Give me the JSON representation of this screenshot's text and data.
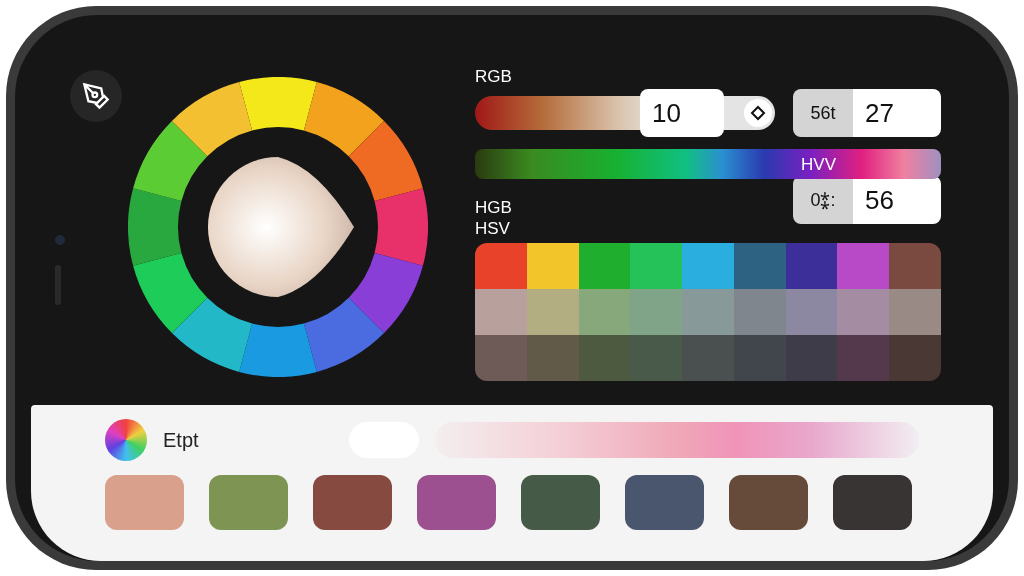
{
  "rgb_slider": {
    "label": "RGB",
    "value": "10"
  },
  "field_top": {
    "label": "56t",
    "value": "27"
  },
  "hue_bar": {
    "label": "HVV"
  },
  "field_bottom": {
    "label": "0⁑:",
    "value": "56"
  },
  "mode_labels": [
    "HGB",
    "HSV"
  ],
  "palette_grid": [
    {
      "cells": [
        {
          "color": "#e8432a"
        },
        {
          "color": "#f2c52a"
        },
        {
          "color": "#1fae2e"
        },
        {
          "color": "#25c25a"
        },
        {
          "color": "#2aaee0"
        },
        {
          "color": "#2d6282"
        },
        {
          "color": "#3c2f9a"
        },
        {
          "color": "#b84ac8"
        },
        {
          "color": "#7a4a40"
        }
      ]
    },
    {
      "cells": [
        {
          "color": "#b8a09c"
        },
        {
          "color": "#b2ae82"
        },
        {
          "color": "#86a87a"
        },
        {
          "color": "#80a488"
        },
        {
          "color": "#88999a"
        },
        {
          "color": "#80868e"
        },
        {
          "color": "#8c88a2"
        },
        {
          "color": "#a48ca2"
        },
        {
          "color": "#9a8a86"
        }
      ]
    },
    {
      "cells": [
        {
          "color": "#6e5a56"
        },
        {
          "color": "#625a48"
        },
        {
          "color": "#4e5a40"
        },
        {
          "color": "#4a5a4a"
        },
        {
          "color": "#4a5050"
        },
        {
          "color": "#40464c"
        },
        {
          "color": "#3e3c48"
        },
        {
          "color": "#54384c"
        },
        {
          "color": "#4a3834"
        }
      ]
    }
  ],
  "bottom": {
    "label": "Etpt",
    "swatches": [
      {
        "color": "#d9a08c"
      },
      {
        "color": "#7e9452"
      },
      {
        "color": "#864a40"
      },
      {
        "color": "#9c5090"
      },
      {
        "color": "#465a48"
      },
      {
        "color": "#4a566e"
      },
      {
        "color": "#664a3a"
      },
      {
        "color": "#383434"
      }
    ]
  }
}
